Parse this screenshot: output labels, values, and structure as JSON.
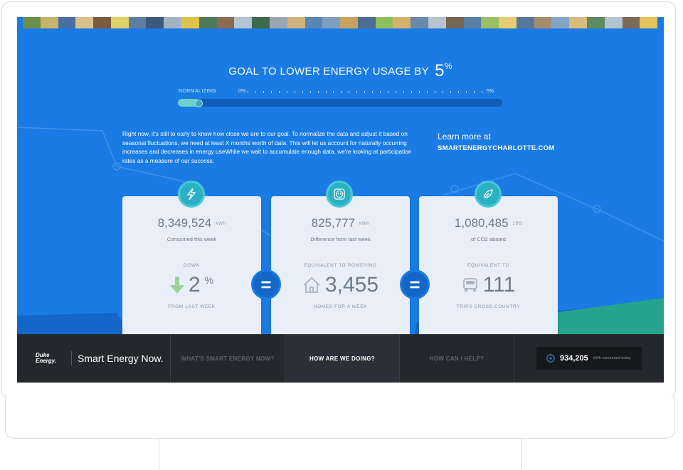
{
  "goal": {
    "title": "GOAL TO LOWER ENERGY USAGE BY",
    "value": "5",
    "unit": "%"
  },
  "progress": {
    "label": "NORMALIZING",
    "start_label": "0%",
    "end_label": "5%",
    "fraction": 0.06
  },
  "intro_text": "Right now, it's still to early to know how close we are to our goal. To normalize the data and adjust it based on seasonal fluctuations, we need at least X months worth of data. This will let us account for naturally occurring increases and decreases in energy useWhile we wait to accumulate enough data, we're looking at participation rates as a measure of our success.",
  "learn_more": {
    "line1": "Learn more at",
    "link": "SMARTENERGYCHARLOTTE.COM"
  },
  "cards": [
    {
      "icon": "lightning-icon",
      "value": "8,349,524",
      "unit": "kWh",
      "subtitle": "Consumed this week",
      "caption_top": "DOWN",
      "big": "2",
      "big_unit": "%",
      "caption_bottom": "FROM LAST WEEK",
      "big_icon": "down-arrow-icon"
    },
    {
      "icon": "outlet-icon",
      "value": "825,777",
      "unit": "kWh",
      "subtitle": "Difference from last week",
      "caption_top": "EQUIVALENT TO POWERING",
      "big": "3,455",
      "caption_bottom": "HOMES FOR A WEEK",
      "big_icon": "house-icon"
    },
    {
      "icon": "leaf-icon",
      "value": "1,080,485",
      "unit": "LBS",
      "subtitle": "of CO2 abated",
      "caption_top": "EQUIVALENT TO",
      "big": "111",
      "caption_bottom": "TRIPS CROSS COUNTRY",
      "big_icon": "car-icon"
    }
  ],
  "equals": "=",
  "nav": {
    "brand_logo": "Duke Energy.",
    "brand_name": "Smart Energy Now.",
    "items": [
      {
        "label": "WHAT'S SMART ENERGY NOW?",
        "active": false
      },
      {
        "label": "HOW ARE WE DOING?",
        "active": true
      },
      {
        "label": "HOW CAN I HELP?",
        "active": false
      }
    ],
    "ticker": {
      "value": "934,205",
      "unit": "kWh consumed today"
    }
  },
  "colors": {
    "screen_bg": "#1a7be4",
    "accent_teal": "#2ab2c4",
    "card_bg": "#e8eff8",
    "down_arrow": "#9bd29b",
    "bar_bg": "#24272c"
  }
}
